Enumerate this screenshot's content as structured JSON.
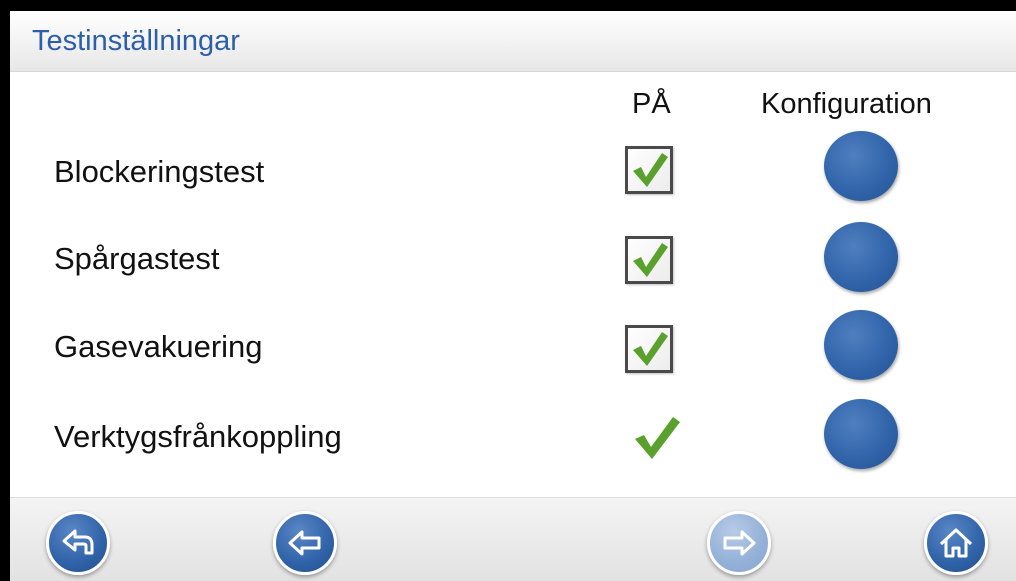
{
  "header": {
    "title": "Testinställningar"
  },
  "columns": {
    "on": "PÅ",
    "configuration": "Konfiguration"
  },
  "rows": [
    {
      "label": "Blockeringstest",
      "on": true,
      "control": "checkbox"
    },
    {
      "label": "Spårgastest",
      "on": true,
      "control": "checkbox"
    },
    {
      "label": "Gasevakuering",
      "on": true,
      "control": "checkbox"
    },
    {
      "label": "Verktygsfrånkoppling",
      "on": true,
      "control": "checkmark"
    }
  ],
  "bottom_nav": {
    "buttons": [
      {
        "icon": "return-arrow-icon",
        "enabled": true
      },
      {
        "icon": "back-arrow-icon",
        "enabled": true
      },
      {
        "icon": "forward-arrow-icon",
        "enabled": false
      },
      {
        "icon": "home-icon",
        "enabled": true
      }
    ]
  },
  "colors": {
    "title": "#2d5fa8",
    "button_blue": "#2f62a8",
    "check_green": "#5aa02c"
  }
}
